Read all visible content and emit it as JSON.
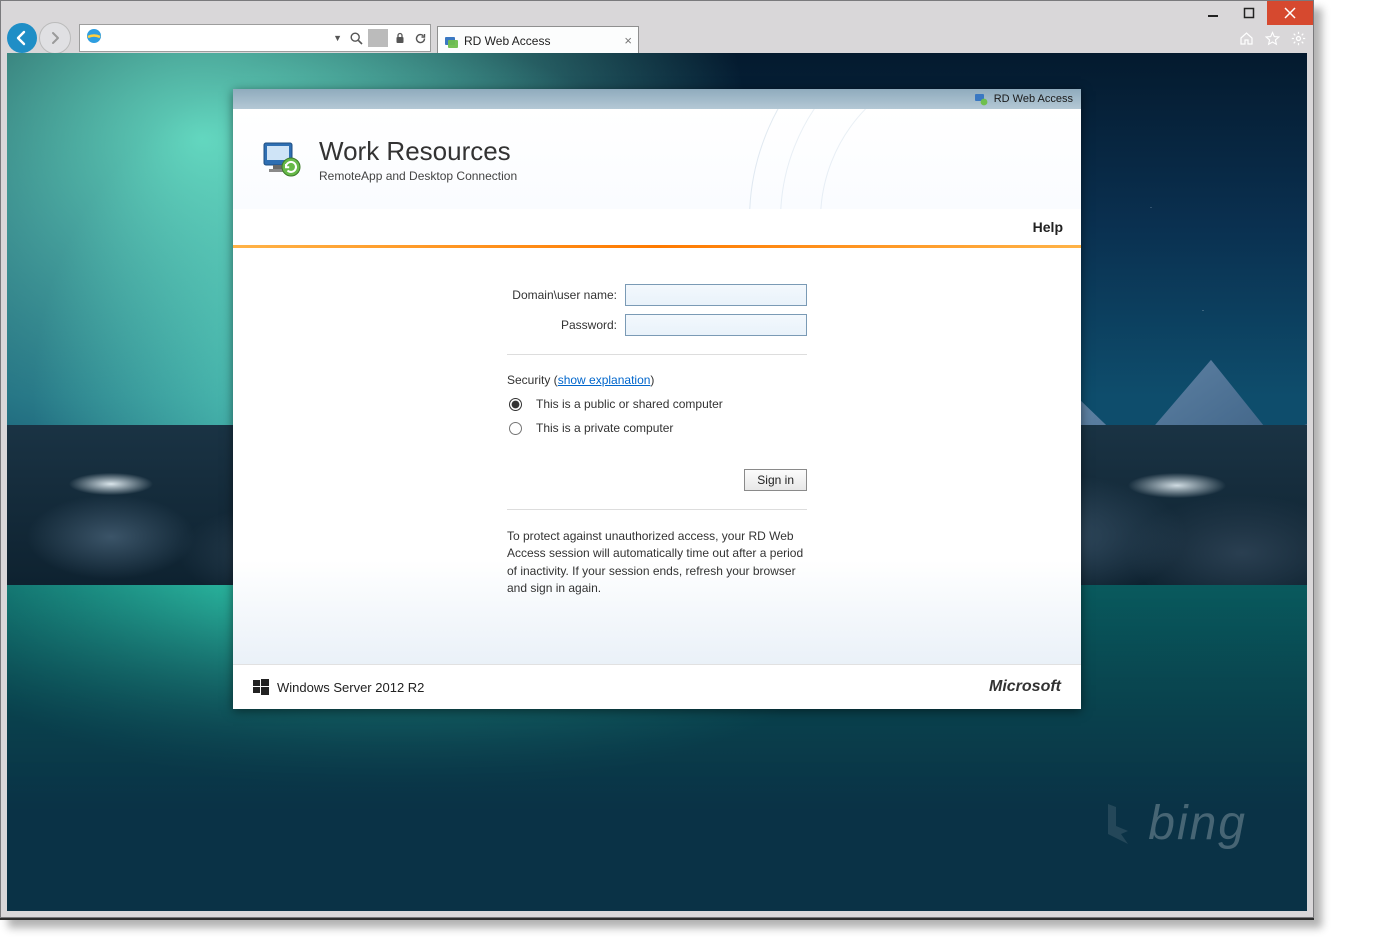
{
  "window": {
    "tab_title": "RD Web Access"
  },
  "address_bar": {
    "value": ""
  },
  "rdweb": {
    "brand_label": "RD Web Access",
    "title": "Work Resources",
    "subtitle": "RemoteApp and Desktop Connection",
    "help_label": "Help",
    "form": {
      "username_label": "Domain\\user name:",
      "username_value": "",
      "password_label": "Password:",
      "password_value": ""
    },
    "security": {
      "prefix": "Security (",
      "link": "show explanation",
      "suffix": ")",
      "option_public": "This is a public or shared computer",
      "option_private": "This is a private computer",
      "selected": "public"
    },
    "signin_label": "Sign in",
    "disclaimer": "To protect against unauthorized access, your RD Web Access session will automatically time out after a period of inactivity. If your session ends, refresh your browser and sign in again.",
    "footer_left": "Windows Server 2012 R2",
    "footer_right": "Microsoft"
  },
  "watermark": "bing"
}
